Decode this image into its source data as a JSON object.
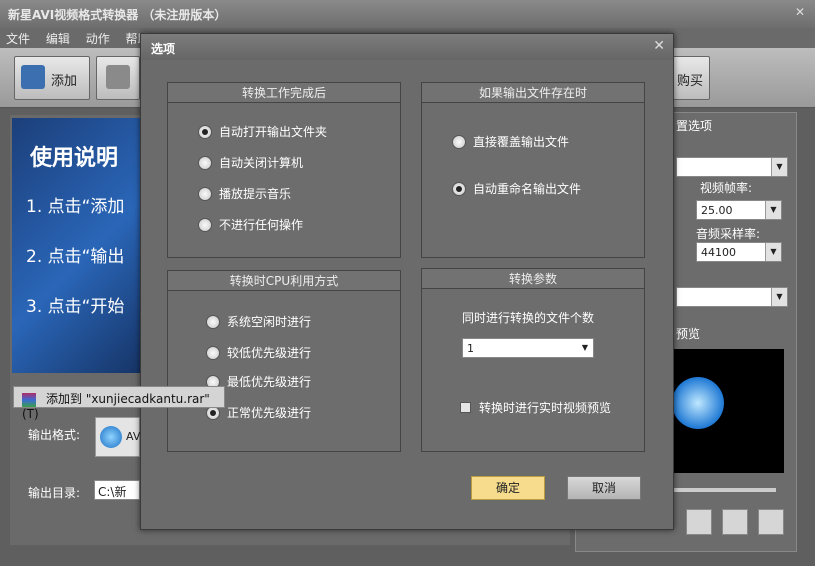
{
  "main": {
    "title": "新星AVI视频格式转换器 （未注册版本）",
    "close_label": "✕",
    "menu": [
      "文件",
      "编辑",
      "动作",
      "帮助"
    ],
    "toolbar": {
      "add_label": "添加",
      "buy_label": "购买"
    },
    "banner": {
      "heading": "使用说明",
      "steps": [
        "1. 点击“添加",
        "2. 点击“输出",
        "3. 点击“开始"
      ]
    },
    "output_format_label": "输出格式:",
    "output_format_value": "AV",
    "output_dir_label": "输出目录:",
    "output_dir_value": "C:\\新星",
    "settings": {
      "title": "置选项",
      "frame_rate_label": "视频帧率:",
      "frame_rate_value": "25.00",
      "sample_rate_label": "音频采样率:",
      "sample_rate_value": "44100"
    },
    "preview_title": "预览"
  },
  "context_menu_item": "添加到 \"xunjiecadkantu.rar\"(T)",
  "dialog": {
    "title": "选项",
    "close_label": "✕",
    "after_complete": {
      "title": "转换工作完成后",
      "options": [
        "自动打开输出文件夹",
        "自动关闭计算机",
        "播放提示音乐",
        "不进行任何操作"
      ],
      "selected_index": 0
    },
    "if_exists": {
      "title": "如果输出文件存在时",
      "options": [
        "直接覆盖输出文件",
        "自动重命名输出文件"
      ],
      "selected_index": 1
    },
    "cpu_mode": {
      "title": "转换时CPU利用方式",
      "options": [
        "系统空闲时进行",
        "较低优先级进行",
        "最低优先级进行",
        "正常优先级进行"
      ],
      "selected_index": 3
    },
    "params": {
      "title": "转换参数",
      "concurrent_label": "同时进行转换的文件个数",
      "concurrent_value": "1",
      "realtime_preview_label": "转换时进行实时视频预览",
      "realtime_preview_checked": false
    },
    "ok_label": "确定",
    "cancel_label": "取消"
  },
  "colors": {
    "accent_button": "#f6dc8c",
    "banner_blue": "#2a66b8"
  }
}
